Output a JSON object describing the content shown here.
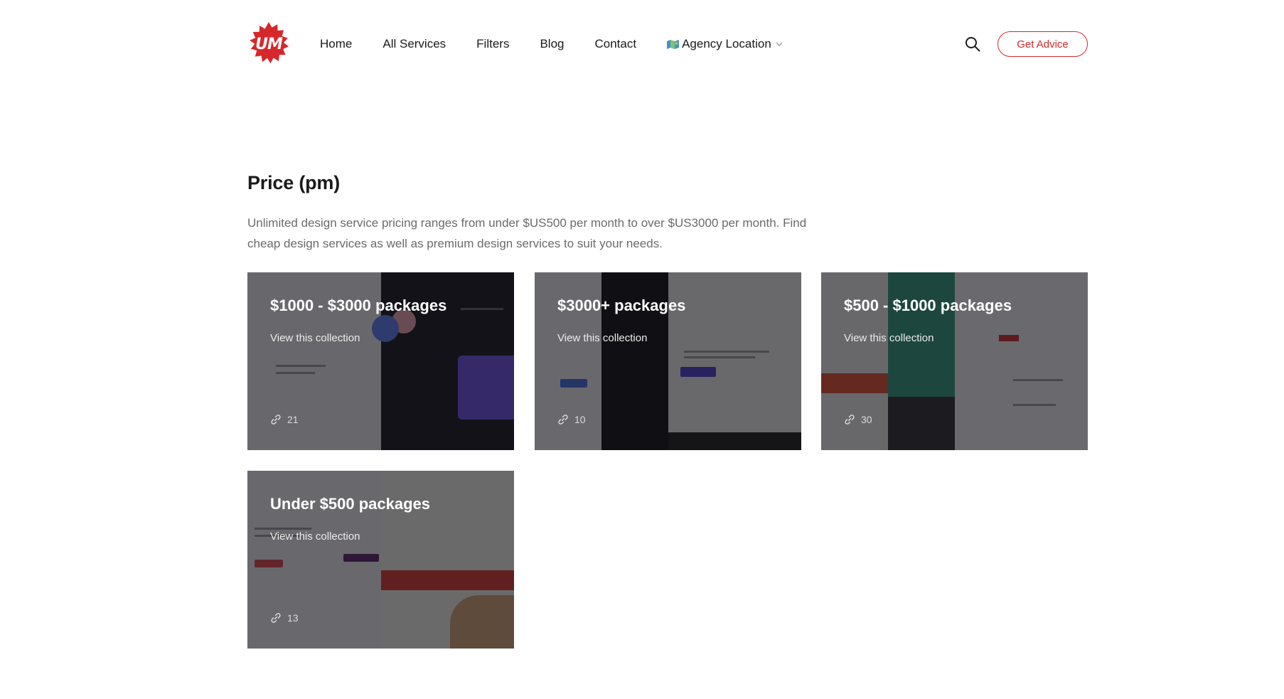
{
  "header": {
    "logo_text": "UM",
    "brand_color": "#d6282b",
    "nav": [
      {
        "label": "Home"
      },
      {
        "label": "All Services"
      },
      {
        "label": "Filters"
      },
      {
        "label": "Blog"
      },
      {
        "label": "Contact"
      },
      {
        "label": "Agency Location",
        "icon": "map-icon",
        "has_dropdown": true
      }
    ],
    "search_icon": "search-icon",
    "cta_label": "Get Advice"
  },
  "intro": {
    "title": "Price (pm)",
    "description": "Unlimited design service pricing ranges from under $US500 per month to over $US3000 per month. Find cheap design services as well as premium design services to suit your needs."
  },
  "collections": [
    {
      "title": "$1000 - $3000 packages",
      "subtitle": "View this collection",
      "count": "21",
      "icon": "link-icon"
    },
    {
      "title": "$3000+ packages",
      "subtitle": "View this collection",
      "count": "10",
      "icon": "link-icon"
    },
    {
      "title": "$500 - $1000 packages",
      "subtitle": "View this collection",
      "count": "30",
      "icon": "link-icon"
    },
    {
      "title": "Under $500 packages",
      "subtitle": "View this collection",
      "count": "13",
      "icon": "link-icon"
    }
  ]
}
